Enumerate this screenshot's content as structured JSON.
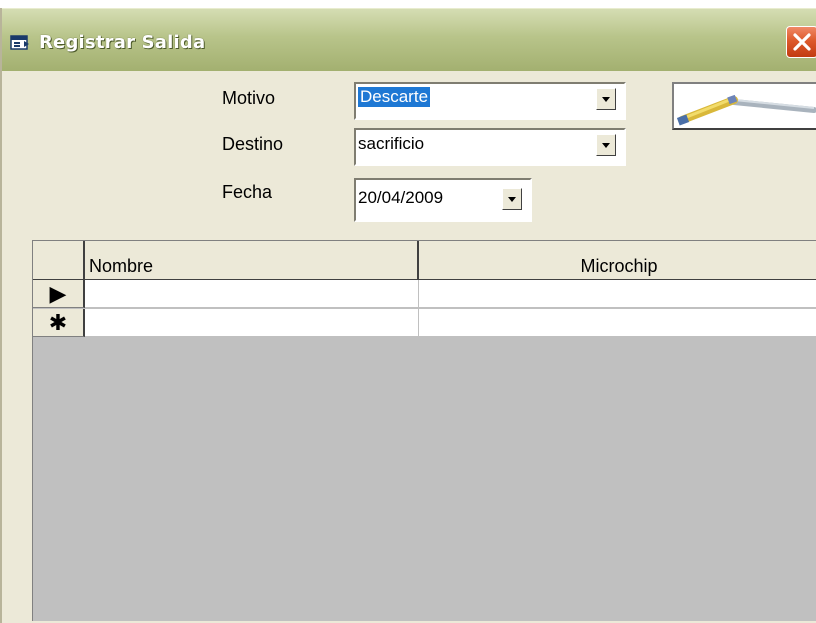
{
  "window": {
    "title": "Registrar Salida",
    "accent_color": "#a3b070"
  },
  "form": {
    "motivo": {
      "label": "Motivo",
      "value": "Descarte"
    },
    "destino": {
      "label": "Destino",
      "value": "sacrificio"
    },
    "fecha": {
      "label": "Fecha",
      "value": "20/04/2009"
    }
  },
  "icons": {
    "app": "form-icon",
    "close": "close-icon",
    "action_image": "measuring-tape-icon",
    "dropdown": "chevron-down-icon",
    "current_row": "triangle-right-icon",
    "new_row": "asterisk-icon"
  },
  "grid": {
    "columns": [
      "Nombre",
      "Microchip"
    ],
    "rows": [
      {
        "marker": "▶",
        "nombre": "",
        "microchip": ""
      },
      {
        "marker": "✱",
        "nombre": "",
        "microchip": ""
      }
    ]
  }
}
